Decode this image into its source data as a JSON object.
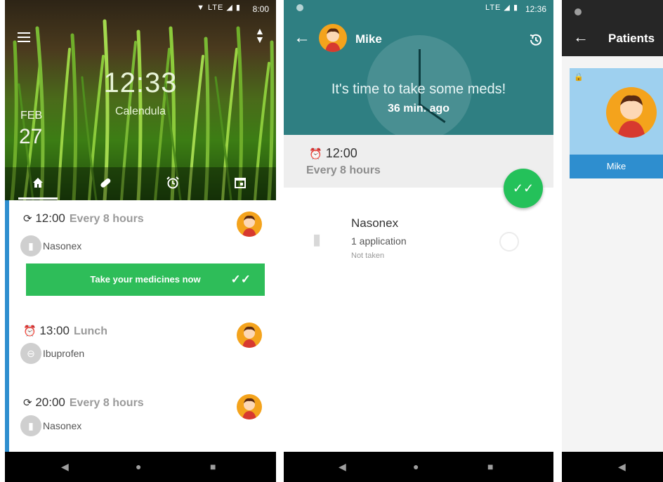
{
  "phone1": {
    "status": {
      "time": "8:00",
      "icons": "▼ LTE ◢ ▮"
    },
    "hero": {
      "time": "12:33",
      "app_name": "Calendula",
      "month": "FEB",
      "day": "27"
    },
    "tabs": [
      {
        "icon": "home-icon",
        "active": true
      },
      {
        "icon": "pill-icon",
        "active": false
      },
      {
        "icon": "alarm-icon",
        "active": false
      },
      {
        "icon": "calendar-icon",
        "active": false
      }
    ],
    "reminders": [
      {
        "time": "12:00",
        "label": "Every 8 hours",
        "medicine": "Nasonex",
        "icon": "repeat-clock-icon",
        "med_icon": "spray-icon"
      },
      {
        "time": "13:00",
        "label": "Lunch",
        "medicine": "Ibuprofen",
        "icon": "alarm-icon",
        "med_icon": "tablet-icon"
      },
      {
        "time": "20:00",
        "label": "Every 8 hours",
        "medicine": "Nasonex",
        "icon": "repeat-clock-icon",
        "med_icon": "spray-icon"
      }
    ],
    "take_button": "Take your medicines now",
    "colors": {
      "accent_blue": "#2e8ecf",
      "green": "#2ebd59"
    }
  },
  "phone2": {
    "status": {
      "time": "12:36",
      "icons": "LTE ◢ ▮"
    },
    "header": {
      "patient": "Mike",
      "message": "It's time to take some meds!",
      "ago": "36 min. ago"
    },
    "dose": {
      "time": "12:00",
      "schedule": "Every 8 hours"
    },
    "medicine": {
      "name": "Nasonex",
      "quantity": "1 application",
      "status": "Not taken"
    },
    "colors": {
      "teal": "#2f7f82",
      "fab": "#24c15a"
    }
  },
  "phone3": {
    "title": "Patients",
    "patient": {
      "name": "Mike"
    },
    "colors": {
      "card": "#9ed0ef",
      "card_foot": "#2e8ecf"
    }
  }
}
